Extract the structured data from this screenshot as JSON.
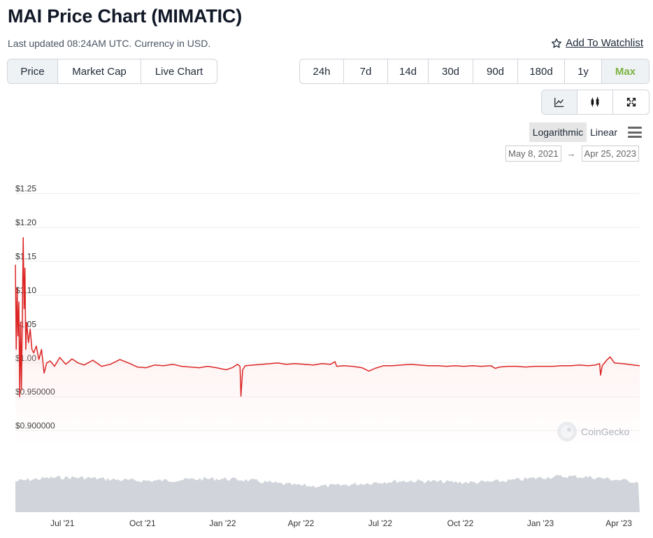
{
  "header": {
    "title": "MAI Price Chart (MIMATIC)",
    "updated": "Last updated 08:24AM UTC. Currency in USD.",
    "watchlist": "Add To Watchlist"
  },
  "tabs": [
    "Price",
    "Market Cap",
    "Live Chart"
  ],
  "ranges": [
    "24h",
    "7d",
    "14d",
    "30d",
    "90d",
    "180d",
    "1y",
    "Max"
  ],
  "chart_types": [
    "line-chart-icon",
    "candlestick-icon",
    "expand-icon"
  ],
  "scale": {
    "log": "Logarithmic",
    "linear": "Linear"
  },
  "date_range": {
    "from": "May 8, 2021",
    "to": "Apr 25, 2023",
    "arrow": "→"
  },
  "watermark": "CoinGecko",
  "colors": {
    "line": "#dc2626",
    "volume": "#d1d5db",
    "max_active": "#7cb342"
  },
  "chart_data": {
    "type": "line",
    "title": "",
    "xlabel": "",
    "ylabel": "",
    "x_range": [
      "2021-05-08",
      "2023-04-25"
    ],
    "ylim": [
      0.88,
      1.26
    ],
    "y_ticks": [
      {
        "value": 1.25,
        "label": "$1.25"
      },
      {
        "value": 1.2,
        "label": "$1.20"
      },
      {
        "value": 1.15,
        "label": "$1.15"
      },
      {
        "value": 1.1,
        "label": "$1.10"
      },
      {
        "value": 1.05,
        "label": "$1.05"
      },
      {
        "value": 1.0,
        "label": "$1.00"
      },
      {
        "value": 0.95,
        "label": "$0.950000"
      },
      {
        "value": 0.9,
        "label": "$0.900000"
      }
    ],
    "x_ticks": [
      {
        "date": "2021-07-01",
        "label": "Jul '21"
      },
      {
        "date": "2021-10-01",
        "label": "Oct '21"
      },
      {
        "date": "2022-01-01",
        "label": "Jan '22"
      },
      {
        "date": "2022-04-01",
        "label": "Apr '22"
      },
      {
        "date": "2022-07-01",
        "label": "Jul '22"
      },
      {
        "date": "2022-10-01",
        "label": "Oct '22"
      },
      {
        "date": "2023-01-01",
        "label": "Jan '23"
      },
      {
        "date": "2023-04-01",
        "label": "Apr '23"
      }
    ],
    "series": [
      {
        "points": [
          [
            "2021-05-08",
            1.145
          ],
          [
            "2021-05-09",
            1.02
          ],
          [
            "2021-05-10",
            1.11
          ],
          [
            "2021-05-11",
            1.04
          ],
          [
            "2021-05-12",
            1.09
          ],
          [
            "2021-05-13",
            0.95
          ],
          [
            "2021-05-14",
            1.06
          ],
          [
            "2021-05-15",
            0.96
          ],
          [
            "2021-05-17",
            1.185
          ],
          [
            "2021-05-18",
            1.08
          ],
          [
            "2021-05-19",
            1.14
          ],
          [
            "2021-05-20",
            1.02
          ],
          [
            "2021-05-21",
            1.06
          ],
          [
            "2021-05-23",
            1.03
          ],
          [
            "2021-05-25",
            1.05
          ],
          [
            "2021-05-27",
            1.02
          ],
          [
            "2021-05-29",
            1.015
          ],
          [
            "2021-06-01",
            1.025
          ],
          [
            "2021-06-04",
            1.005
          ],
          [
            "2021-06-07",
            1.02
          ],
          [
            "2021-06-10",
            0.985
          ],
          [
            "2021-06-13",
            1.0
          ],
          [
            "2021-06-17",
            1.003
          ],
          [
            "2021-06-22",
            0.995
          ],
          [
            "2021-06-28",
            1.008
          ],
          [
            "2021-07-05",
            0.998
          ],
          [
            "2021-07-12",
            1.006
          ],
          [
            "2021-07-19",
            1.0
          ],
          [
            "2021-07-26",
            0.997
          ],
          [
            "2021-08-05",
            1.004
          ],
          [
            "2021-08-15",
            0.995
          ],
          [
            "2021-08-25",
            0.998
          ],
          [
            "2021-09-05",
            1.005
          ],
          [
            "2021-09-15",
            1.0
          ],
          [
            "2021-09-25",
            0.994
          ],
          [
            "2021-10-05",
            0.993
          ],
          [
            "2021-10-15",
            0.997
          ],
          [
            "2021-10-25",
            0.996
          ],
          [
            "2021-11-05",
            0.998
          ],
          [
            "2021-11-15",
            0.995
          ],
          [
            "2021-11-25",
            0.994
          ],
          [
            "2021-12-05",
            0.993
          ],
          [
            "2021-12-15",
            0.995
          ],
          [
            "2021-12-25",
            0.993
          ],
          [
            "2022-01-05",
            0.99
          ],
          [
            "2022-01-12",
            0.993
          ],
          [
            "2022-01-18",
            0.998
          ],
          [
            "2022-01-21",
            0.995
          ],
          [
            "2022-01-22",
            0.951
          ],
          [
            "2022-01-24",
            0.99
          ],
          [
            "2022-01-27",
            0.996
          ],
          [
            "2022-02-05",
            0.997
          ],
          [
            "2022-02-15",
            0.998
          ],
          [
            "2022-02-25",
            0.999
          ],
          [
            "2022-03-05",
            1.0
          ],
          [
            "2022-03-15",
            0.998
          ],
          [
            "2022-03-25",
            0.999
          ],
          [
            "2022-04-05",
            0.998
          ],
          [
            "2022-04-15",
            0.997
          ],
          [
            "2022-04-25",
            0.999
          ],
          [
            "2022-05-05",
            0.998
          ],
          [
            "2022-05-10",
            1.002
          ],
          [
            "2022-05-12",
            0.995
          ],
          [
            "2022-05-20",
            0.996
          ],
          [
            "2022-05-30",
            0.995
          ],
          [
            "2022-06-10",
            0.993
          ],
          [
            "2022-06-18",
            0.988
          ],
          [
            "2022-06-25",
            0.992
          ],
          [
            "2022-07-05",
            0.996
          ],
          [
            "2022-07-15",
            0.996
          ],
          [
            "2022-07-25",
            0.997
          ],
          [
            "2022-08-05",
            0.998
          ],
          [
            "2022-08-15",
            0.997
          ],
          [
            "2022-08-25",
            0.996
          ],
          [
            "2022-09-05",
            0.996
          ],
          [
            "2022-09-15",
            0.995
          ],
          [
            "2022-09-25",
            0.996
          ],
          [
            "2022-10-05",
            0.995
          ],
          [
            "2022-10-15",
            0.996
          ],
          [
            "2022-10-25",
            0.995
          ],
          [
            "2022-11-05",
            0.996
          ],
          [
            "2022-11-10",
            0.992
          ],
          [
            "2022-11-15",
            0.994
          ],
          [
            "2022-11-25",
            0.995
          ],
          [
            "2022-12-05",
            0.995
          ],
          [
            "2022-12-15",
            0.994
          ],
          [
            "2022-12-25",
            0.995
          ],
          [
            "2023-01-05",
            0.995
          ],
          [
            "2023-01-15",
            0.995
          ],
          [
            "2023-01-25",
            0.996
          ],
          [
            "2023-02-05",
            0.996
          ],
          [
            "2023-02-15",
            0.997
          ],
          [
            "2023-02-25",
            0.996
          ],
          [
            "2023-03-05",
            0.997
          ],
          [
            "2023-03-10",
            0.999
          ],
          [
            "2023-03-11",
            0.982
          ],
          [
            "2023-03-13",
            0.996
          ],
          [
            "2023-03-18",
            1.004
          ],
          [
            "2023-03-22",
            1.009
          ],
          [
            "2023-03-27",
            1.0
          ],
          [
            "2023-04-05",
            0.999
          ],
          [
            "2023-04-12",
            0.998
          ],
          [
            "2023-04-18",
            0.997
          ],
          [
            "2023-04-25",
            0.996
          ]
        ]
      }
    ]
  }
}
